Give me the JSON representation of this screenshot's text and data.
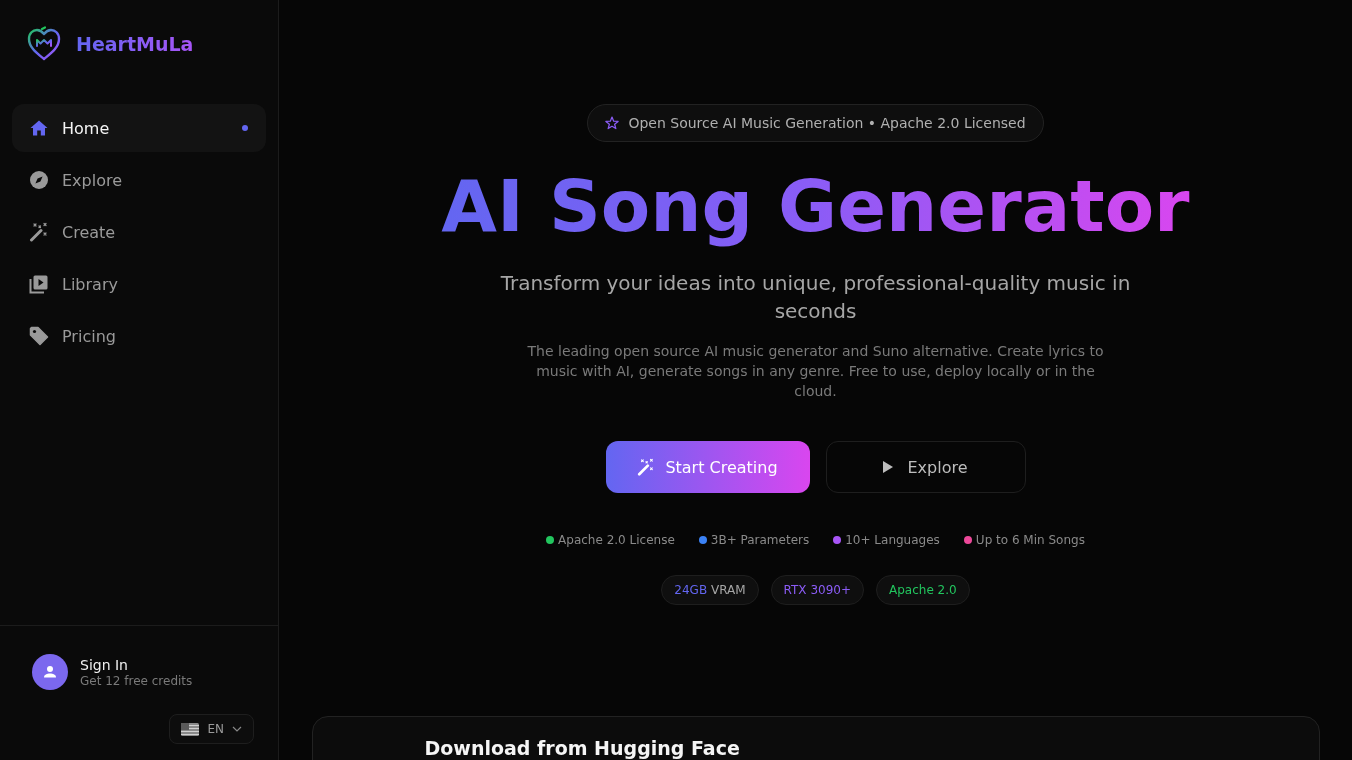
{
  "sidebar": {
    "brand": "HeartMuLa",
    "nav_items": [
      {
        "label": "Home",
        "kind": "home",
        "selected": true
      },
      {
        "label": "Explore",
        "kind": "compass",
        "selected": false
      },
      {
        "label": "Create",
        "kind": "wand",
        "selected": false
      },
      {
        "label": "Library",
        "kind": "library",
        "selected": false
      },
      {
        "label": "Pricing",
        "kind": "tag",
        "selected": false
      }
    ],
    "account": {
      "title": "Sign In",
      "subtitle": "Get 12 free credits"
    },
    "language": "EN"
  },
  "hero": {
    "badge": "Open Source AI Music Generation • Apache 2.0 Licensed",
    "title": "AI Song Generator",
    "subtitle": "Transform your ideas into unique, professional-quality music in seconds",
    "description": "The leading open source AI music generator and Suno alternative. Create lyrics to music with AI, generate songs in any genre. Free to use, deploy locally or in the cloud.",
    "buttons": [
      {
        "label": "Start Creating",
        "kind": "primary"
      },
      {
        "label": "Explore",
        "kind": "secondary"
      }
    ],
    "features": [
      {
        "label": "Apache 2.0 License",
        "color": "#22c55e"
      },
      {
        "label": "3B+ Parameters",
        "color": "#3b82f6"
      },
      {
        "label": "10+ Languages",
        "color": "#a855f7"
      },
      {
        "label": "Up to 6 Min Songs",
        "color": "#ec4899"
      }
    ],
    "tags": [
      {
        "label": "24GB",
        "suffix": "VRAM",
        "color": "#6366f1"
      },
      {
        "label": "RTX 3090+",
        "color": "#8b5cf6"
      },
      {
        "label": "Apache 2.0",
        "color": "#22c55e"
      }
    ]
  },
  "download_card": {
    "title": "Download from Hugging Face"
  }
}
